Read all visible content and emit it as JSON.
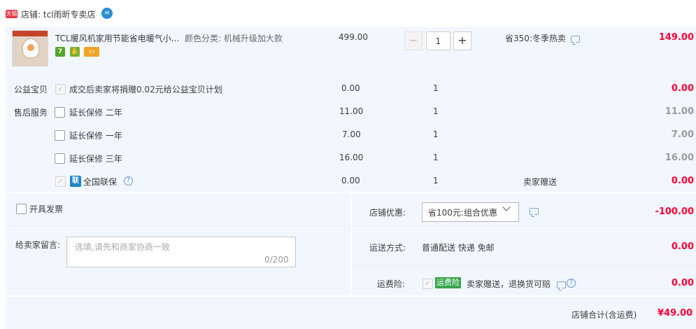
{
  "shop": {
    "badge": "天猫",
    "label": "店铺: tcl雨昕专卖店",
    "chat_icon": "chat-bubble-icon"
  },
  "item": {
    "title": "TCL暖风机家用节能省电暖气小...",
    "spec": "颜色分类: 机械升级加大款",
    "unit_price": "499.00",
    "quantity": "1",
    "minus_label": "−",
    "plus_label": "+",
    "discount": "省350:冬季热卖",
    "total": "149.00",
    "service_icons": [
      {
        "label": "7",
        "icon": "seven-day-return-icon"
      },
      {
        "label": "",
        "icon": "service-guarantee-icon"
      },
      {
        "label": "",
        "icon": "credit-card-icon"
      }
    ]
  },
  "charity": {
    "row_label": "公益宝贝",
    "text": "成交后卖家将捐赠0.02元给公益宝贝计划",
    "price": "0.00",
    "qty": "1",
    "total": "0.00"
  },
  "after_sales": {
    "row_label": "售后服务",
    "options": [
      {
        "name": "延长保修 二年",
        "price": "11.00",
        "qty": "1",
        "total": "11.00"
      },
      {
        "name": "延长保修 一年",
        "price": "7.00",
        "qty": "1",
        "total": "7.00"
      },
      {
        "name": "延长保修 三年",
        "price": "16.00",
        "qty": "1",
        "total": "16.00"
      }
    ],
    "national": {
      "name": "全国联保",
      "icon_label": "联",
      "price": "0.00",
      "qty": "1",
      "note": "卖家赠送",
      "total": "0.00"
    }
  },
  "invoice": {
    "label": "开具发票"
  },
  "memo": {
    "label": "给卖家留言:",
    "placeholder": "选填,请先和商家协商一致",
    "count": "0/200"
  },
  "shop_discount": {
    "label": "店铺优惠:",
    "selected": "省100元:组合优惠",
    "total": "-100.00"
  },
  "shipping": {
    "label": "运送方式:",
    "value": "普通配送 快递 免邮",
    "total": "0.00"
  },
  "freight_insurance": {
    "label": "运费险:",
    "tag": "运费险",
    "text": "卖家赠送，退换货可赔",
    "total": "0.00"
  },
  "footer": {
    "label": "店铺合计(含运费)",
    "amount": "¥49.00"
  },
  "colors": {
    "accent_red": "#ff0036",
    "panel_bg": "#f2f7ff",
    "tmall_red": "#e5353c",
    "insurance_green": "#35a64c"
  }
}
